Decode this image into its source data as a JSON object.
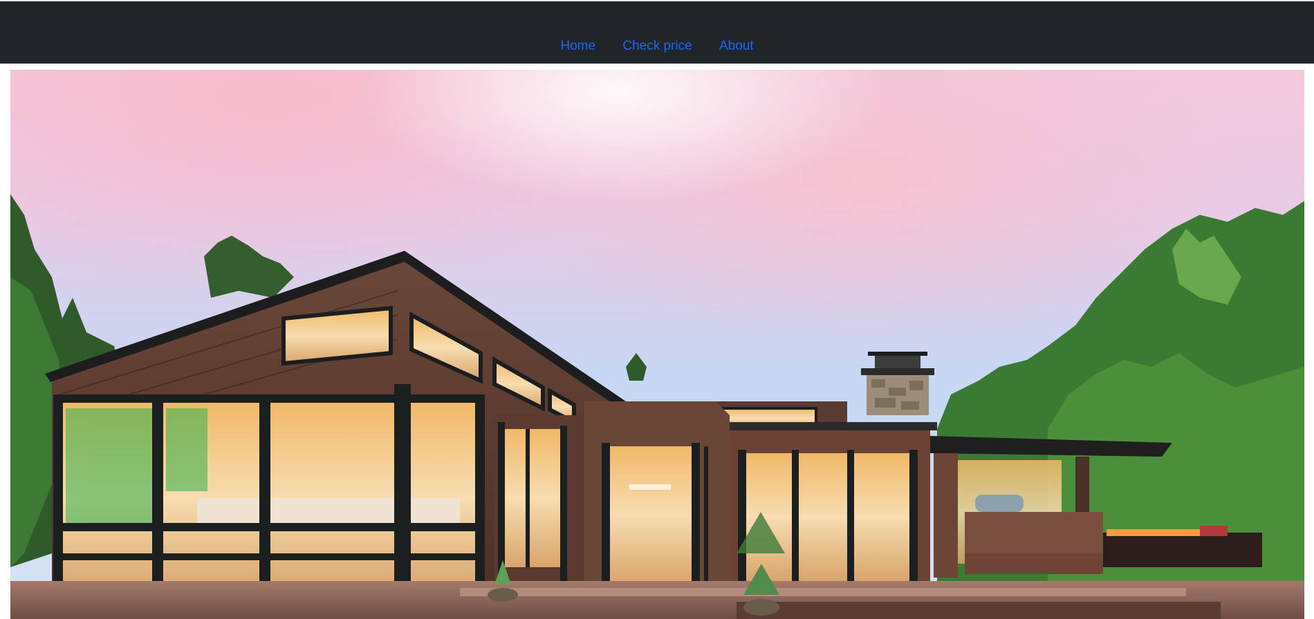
{
  "navbar": {
    "background": "#212529",
    "link_color": "#1a66ff",
    "links": [
      {
        "label": "Home"
      },
      {
        "label": "Check price"
      },
      {
        "label": "About"
      }
    ]
  },
  "hero": {
    "image_subject": "modern-house-photo"
  }
}
